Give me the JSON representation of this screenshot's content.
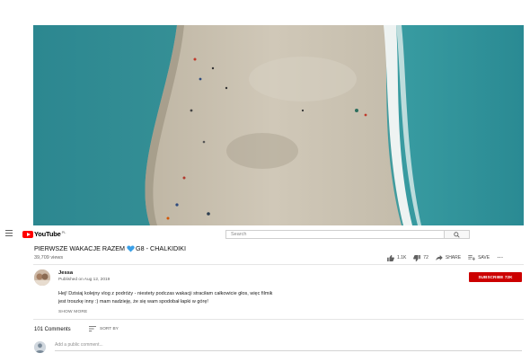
{
  "video": {
    "colors": {
      "sea": "#2e8d94",
      "sand": "#c9c2b3",
      "foam": "#eef3f2"
    }
  },
  "masthead": {
    "logo_text": "YouTube",
    "logo_sup": "PL",
    "search_placeholder": "Search"
  },
  "video_info": {
    "title_part1": "PIERWSZE WAKACJE RAZEM",
    "title_part2": "G8 - CHALKIDIKI",
    "views": "39,709 views",
    "likes": "1.1K",
    "dislikes": "72",
    "share": "SHARE",
    "save": "SAVE",
    "more": "⋯"
  },
  "channel": {
    "name": "Jessa",
    "published": "Published on Aug 12, 2019",
    "subscribe": "SUBSCRIBE",
    "subscribers": "72K",
    "description_line1": "Hej! Dzisiaj kolejny vlog z podróży - niestety podczas wakacji straciłam całkowicie głos, więc filmik",
    "description_line2": "jest troszkę inny :) mam nadzieję, że się wam spodobał łapki w górę!",
    "show_more": "SHOW MORE"
  },
  "comments": {
    "count": "101 Comments",
    "sort_by": "SORT BY",
    "add_placeholder": "Add a public comment..."
  },
  "colors": {
    "brand_red": "#ff0000",
    "subscribe_red": "#cc0000"
  }
}
